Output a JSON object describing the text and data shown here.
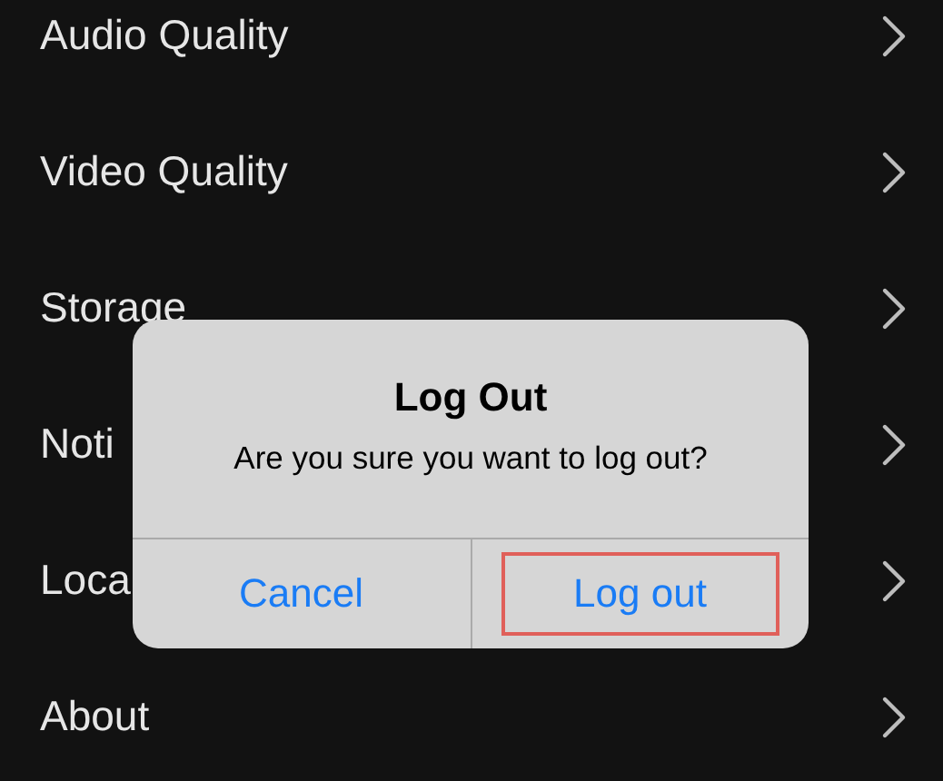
{
  "settings_items": [
    {
      "label": "Audio Quality"
    },
    {
      "label": "Video Quality"
    },
    {
      "label": "Storage"
    },
    {
      "label": "Noti"
    },
    {
      "label": "Loca"
    },
    {
      "label": "About"
    }
  ],
  "dialog": {
    "title": "Log Out",
    "message": "Are you sure you want to log out?",
    "buttons": [
      {
        "label": "Cancel",
        "highlighted": false
      },
      {
        "label": "Log out",
        "highlighted": true
      }
    ]
  }
}
